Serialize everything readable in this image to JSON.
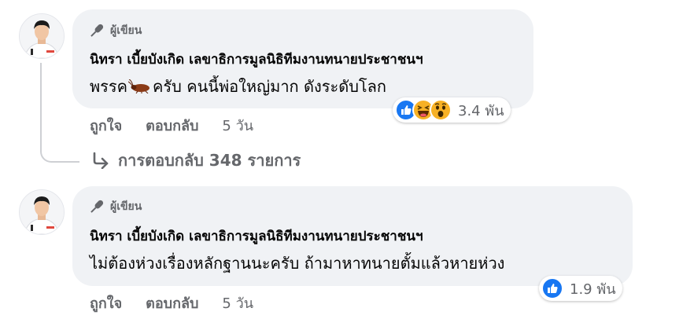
{
  "comments": [
    {
      "author_badge": "ผู้เขียน",
      "author": "นิทรา เบี้ยบังเกิด เลขาธิการมูลนิธิทีมงานทนายประชาชนฯ",
      "text_before": "พรรค",
      "text_after": "ครับ คนนี้พ่อใหญ่มาก ดังระดับโลก",
      "reactions": [
        "like",
        "haha",
        "wow"
      ],
      "reaction_count": "3.4 พัน",
      "like_label": "ถูกใจ",
      "reply_label": "ตอบกลับ",
      "timestamp": "5 วัน"
    },
    {
      "author_badge": "ผู้เขียน",
      "author": "นิทรา เบี้ยบังเกิด เลขาธิการมูลนิธิทีมงานทนายประชาชนฯ",
      "text": "ไม่ต้องห่วงเรื่องหลักฐานนะครับ ถ้ามาหาทนายตั้มแล้วหายห่วง",
      "reactions": [
        "like"
      ],
      "reaction_count": "1.9 พัน",
      "like_label": "ถูกใจ",
      "reply_label": "ตอบกลับ",
      "timestamp": "5 วัน"
    }
  ],
  "view_replies": "การตอบกลับ 348 รายการ",
  "colors": {
    "like_blue": "#1877f2",
    "reaction_yellow": "#f7b125",
    "bubble": "#f0f2f5",
    "secondary_text": "#65676b"
  }
}
